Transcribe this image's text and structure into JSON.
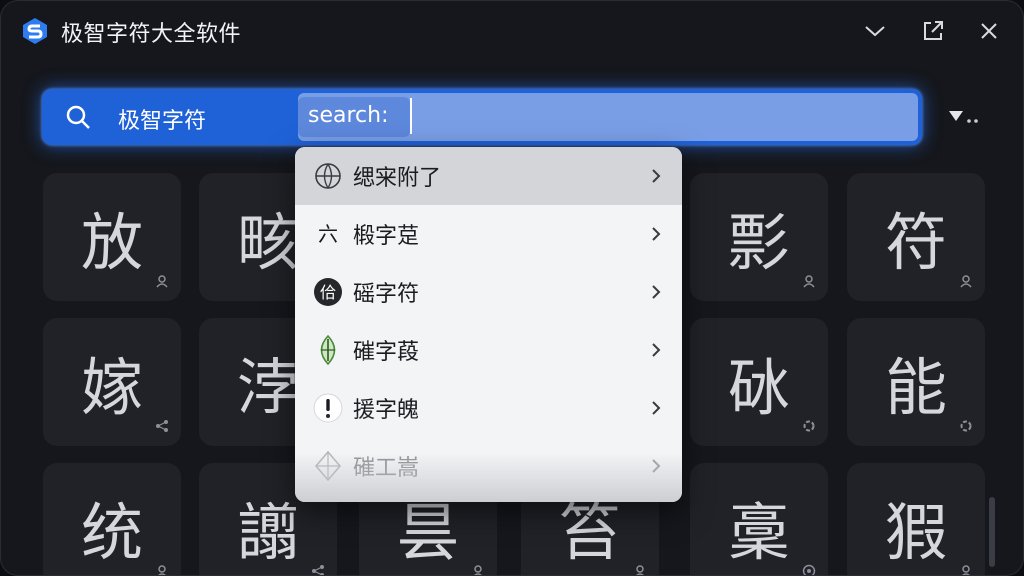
{
  "app": {
    "title": "极智字符大全软件",
    "accent_color": "#1f62d8"
  },
  "window_controls": {
    "collapse_icon": "chevron-down-icon",
    "popout_icon": "external-link-icon",
    "close_icon": "close-icon"
  },
  "search": {
    "query": "极智字符",
    "field_text": "search:",
    "icon": "search-icon",
    "filter_icon": "filter-dropdown-icon"
  },
  "grid": {
    "tiles": [
      {
        "char": "放",
        "badge": "person-icon"
      },
      {
        "char": "畡",
        "badge": "person-icon"
      },
      {
        "char": "彯",
        "badge": "person-icon"
      },
      {
        "char": "符",
        "badge": "person-icon"
      },
      {
        "char": "嫁",
        "badge": "share-icon"
      },
      {
        "char": "浡",
        "badge": "share-icon"
      },
      {
        "char": "砅",
        "badge": "refresh-icon"
      },
      {
        "char": "能",
        "badge": "refresh-icon"
      },
      {
        "char": "统",
        "badge": "person-icon"
      },
      {
        "char": "譾",
        "badge": "share-icon"
      },
      {
        "char": "昙",
        "badge": "person-icon"
      },
      {
        "char": "笞",
        "badge": "person-icon"
      },
      {
        "char": "稾",
        "badge": "shield-icon"
      },
      {
        "char": "猳",
        "badge": "person-icon"
      }
    ]
  },
  "dropdown": {
    "items": [
      {
        "label": "缌宩附了",
        "icon": "globe-emblem-icon"
      },
      {
        "label": "椴字莡",
        "icon": "six-glyph-icon"
      },
      {
        "label": "磘字符",
        "icon": "seal-icon"
      },
      {
        "label": "磪字葮",
        "icon": "leaf-emblem-icon"
      },
      {
        "label": "援字魄",
        "icon": "exclamation-icon"
      },
      {
        "label": "磪工嵩",
        "icon": "diamond-emblem-icon"
      }
    ]
  }
}
